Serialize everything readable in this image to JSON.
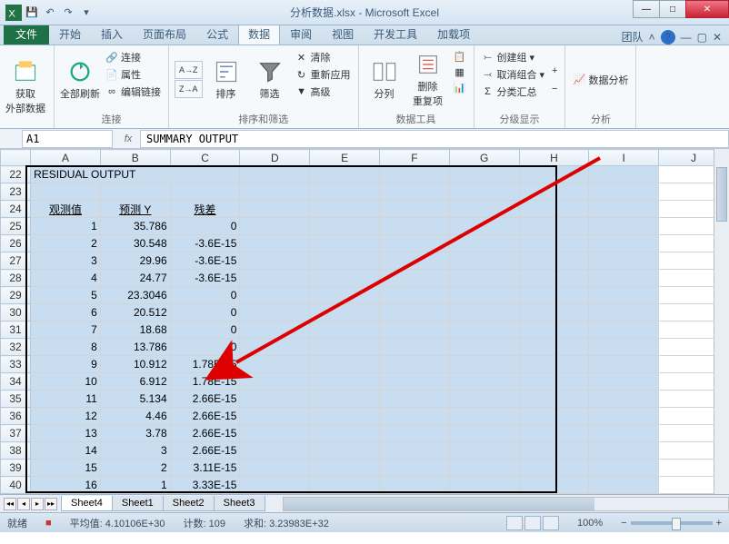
{
  "window": {
    "title": "分析数据.xlsx - Microsoft Excel"
  },
  "qat": {
    "save": "💾",
    "undo": "↶",
    "redo": "↷"
  },
  "tabs": {
    "file": "文件",
    "home": "开始",
    "insert": "插入",
    "layout": "页面布局",
    "formulas": "公式",
    "data": "数据",
    "review": "审阅",
    "view": "视图",
    "dev": "开发工具",
    "addin": "加载项",
    "team": "团队"
  },
  "ribbon": {
    "get_data": "获取\n外部数据",
    "refresh": "全部刷新",
    "conn": "连接",
    "props": "属性",
    "editlinks": "编辑链接",
    "sort_asc": "A→Z",
    "sort_desc": "Z→A",
    "sort": "排序",
    "filter": "筛选",
    "clear": "清除",
    "reapply": "重新应用",
    "advanced": "高级",
    "texttocols": "分列",
    "removedup": "删除\n重复项",
    "group": "创建组",
    "ungroup": "取消组合",
    "subtotal": "分类汇总",
    "analysis": "数据分析",
    "grp_conn": "连接",
    "grp_sort": "排序和筛选",
    "grp_tools": "数据工具",
    "grp_outline": "分级显示",
    "grp_analysis": "分析"
  },
  "formula_bar": {
    "cell": "A1",
    "fx": "fx",
    "value": "SUMMARY OUTPUT"
  },
  "chart_data": {
    "type": "table",
    "title": "RESIDUAL OUTPUT",
    "columns": [
      "观测值",
      "预测 Y",
      "残差"
    ],
    "rows": [
      {
        "obs": 1,
        "pred": "35.786",
        "resid": "0"
      },
      {
        "obs": 2,
        "pred": "30.548",
        "resid": "-3.6E-15"
      },
      {
        "obs": 3,
        "pred": "29.96",
        "resid": "-3.6E-15"
      },
      {
        "obs": 4,
        "pred": "24.77",
        "resid": "-3.6E-15"
      },
      {
        "obs": 5,
        "pred": "23.3046",
        "resid": "0"
      },
      {
        "obs": 6,
        "pred": "20.512",
        "resid": "0"
      },
      {
        "obs": 7,
        "pred": "18.68",
        "resid": "0"
      },
      {
        "obs": 8,
        "pred": "13.786",
        "resid": "0"
      },
      {
        "obs": 9,
        "pred": "10.912",
        "resid": "1.78E-15"
      },
      {
        "obs": 10,
        "pred": "6.912",
        "resid": "1.78E-15"
      },
      {
        "obs": 11,
        "pred": "5.134",
        "resid": "2.66E-15"
      },
      {
        "obs": 12,
        "pred": "4.46",
        "resid": "2.66E-15"
      },
      {
        "obs": 13,
        "pred": "3.78",
        "resid": "2.66E-15"
      },
      {
        "obs": 14,
        "pred": "3",
        "resid": "2.66E-15"
      },
      {
        "obs": 15,
        "pred": "2",
        "resid": "3.11E-15"
      },
      {
        "obs": 16,
        "pred": "1",
        "resid": "3.33E-15"
      }
    ]
  },
  "row_start": 22,
  "columns": [
    "A",
    "B",
    "C",
    "D",
    "E",
    "F",
    "G",
    "H",
    "I",
    "J"
  ],
  "sheets": {
    "s4": "Sheet4",
    "s1": "Sheet1",
    "s2": "Sheet2",
    "s3": "Sheet3"
  },
  "status": {
    "mode": "就绪",
    "rec": "■",
    "avg": "平均值: 4.10106E+30",
    "count": "计数: 109",
    "sum": "求和: 3.23983E+32",
    "zoom": "100%",
    "minus": "−",
    "plus": "+"
  }
}
